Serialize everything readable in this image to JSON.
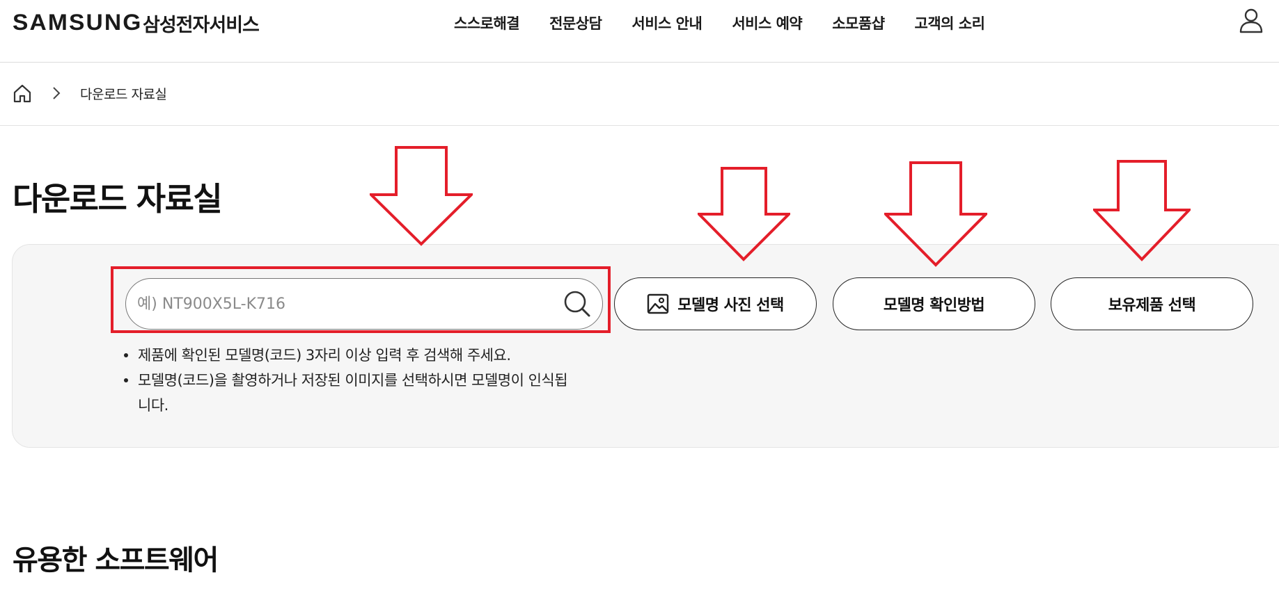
{
  "header": {
    "logo": "SAMSUNG",
    "logo_sub": "삼성전자서비스",
    "nav": [
      "스스로해결",
      "전문상담",
      "서비스 안내",
      "서비스 예약",
      "소모품샵",
      "고객의 소리"
    ],
    "user_icon": "user-icon"
  },
  "breadcrumb": {
    "home_icon": "home-icon",
    "current": "다운로드 자료실"
  },
  "page": {
    "title": "다운로드 자료실"
  },
  "search": {
    "placeholder": "예) NT900X5L-K716",
    "value": "",
    "icon": "search-icon",
    "buttons": {
      "photo": "모델명 사진 선택",
      "howto": "모델명 확인방법",
      "owned": "보유제품 선택"
    },
    "notes": [
      "제품에 확인된 모델명(코드) 3자리 이상 입력 후 검색해 주세요.",
      "모델명(코드)을 촬영하거나 저장된 이미지를 선택하시면 모델명이 인식됩니다."
    ]
  },
  "sections": {
    "useful_software": "유용한 소프트웨어"
  },
  "annotation": {
    "highlight_color": "#e41e2a"
  }
}
